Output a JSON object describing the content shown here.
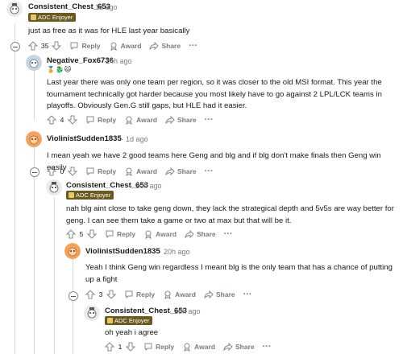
{
  "comments": [
    {
      "username": "Consistent_Chest_653",
      "time": "1d ago",
      "flair": "ADC Enjoyer",
      "body": "just as free as it was for HLE last year basically",
      "votes": "35",
      "reply": "Reply",
      "award": "Award",
      "share": "Share",
      "avatar_color": "#e9eaeb"
    },
    {
      "username": "Negative_Fox6736",
      "time": "14h ago",
      "emblems": "🏅🐉🐱",
      "body": "Last year there was only one team per region, so it was closer to the old MSI format. This year the tournament technically got harder because you most likely have to go against 2 LPL/LCK teams in playoffs. Obviously Gen.G still gaps, but HLE had it easier.",
      "votes": "4",
      "reply": "Reply",
      "award": "Award",
      "share": "Share",
      "avatar_color": "#c8d4e0"
    },
    {
      "username": "ViolinistSudden1835",
      "time": "1d ago",
      "body": "I mean yeah we have 2 good teams here Geng and blg and if blg don't make finals then Geng win easily",
      "votes": "0",
      "reply": "Reply",
      "award": "Award",
      "share": "Share",
      "avatar_color": "#f4a15c"
    },
    {
      "username": "Consistent_Chest_653",
      "time": "20h ago",
      "flair": "ADC Enjoyer",
      "body": "nah blg aint close to take geng down, they lack the strategical depth and 5v5s are way better for geng. I can see them take a game or two at max but that will be it.",
      "votes": "5",
      "reply": "Reply",
      "award": "Award",
      "share": "Share",
      "avatar_color": "#e9eaeb"
    },
    {
      "username": "ViolinistSudden1835",
      "time": "20h ago",
      "body": "Yeah I think Geng win regardless I meant blg is the only team that has a chance of putting up a fight",
      "votes": "3",
      "reply": "Reply",
      "award": "Award",
      "share": "Share",
      "avatar_color": "#f4a15c"
    },
    {
      "username": "Consistent_Chest_653",
      "time": "20h ago",
      "flair": "ADC Enjoyer",
      "body": "oh yeah i agree",
      "votes": "1",
      "reply": "Reply",
      "award": "Award",
      "share": "Share",
      "avatar_color": "#e9eaeb"
    }
  ],
  "colors": {
    "flair_bg": "#6b5a1e",
    "muted": "#787c7e",
    "thread_line": "#d8dadc"
  }
}
